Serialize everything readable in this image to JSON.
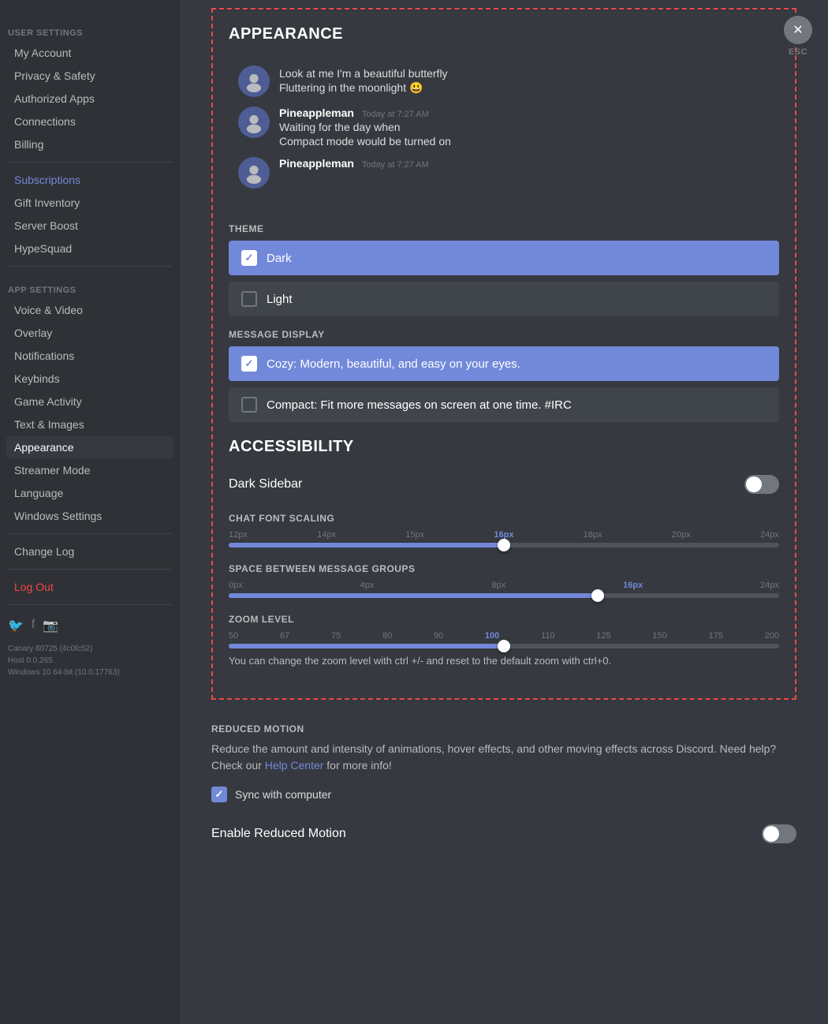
{
  "sidebar": {
    "user_settings_label": "USER SETTINGS",
    "app_settings_label": "APP SETTINGS",
    "items": {
      "my_account": "My Account",
      "privacy_safety": "Privacy & Safety",
      "authorized_apps": "Authorized Apps",
      "connections": "Connections",
      "billing": "Billing",
      "subscriptions": "Subscriptions",
      "gift_inventory": "Gift Inventory",
      "server_boost": "Server Boost",
      "hypesquad": "HypeSquad",
      "voice_video": "Voice & Video",
      "overlay": "Overlay",
      "notifications": "Notifications",
      "keybinds": "Keybinds",
      "game_activity": "Game Activity",
      "text_images": "Text & Images",
      "appearance": "Appearance",
      "streamer_mode": "Streamer Mode",
      "language": "Language",
      "windows_settings": "Windows Settings",
      "change_log": "Change Log",
      "log_out": "Log Out"
    }
  },
  "esc": {
    "label": "ESC"
  },
  "appearance": {
    "title": "APPEARANCE",
    "chat_preview": {
      "messages": [
        {
          "id": "msg1",
          "show_avatar": true,
          "avatar_type": "pineappleman",
          "show_author": false,
          "text": "Look at me I'm a beautiful butterfly",
          "text2": "Fluttering in the moonlight 😃"
        },
        {
          "id": "msg2",
          "show_avatar": true,
          "avatar_type": "pineappleman",
          "author": "Pineappleman",
          "timestamp": "Today at 7:27 AM",
          "text": "Waiting for the day when",
          "text2": "Compact mode would be turned on"
        },
        {
          "id": "msg3",
          "show_avatar": true,
          "avatar_type": "pineappleman",
          "author": "Pineappleman",
          "timestamp": "Today at 7:27 AM",
          "text": ""
        }
      ]
    },
    "theme_label": "THEME",
    "themes": [
      {
        "id": "dark",
        "label": "Dark",
        "selected": true
      },
      {
        "id": "light",
        "label": "Light",
        "selected": false
      }
    ],
    "message_display_label": "MESSAGE DISPLAY",
    "message_displays": [
      {
        "id": "cozy",
        "label": "Cozy: Modern, beautiful, and easy on your eyes.",
        "selected": true
      },
      {
        "id": "compact",
        "label": "Compact: Fit more messages on screen at one time. #IRC",
        "selected": false
      }
    ]
  },
  "accessibility": {
    "title": "ACCESSIBILITY",
    "dark_sidebar": {
      "label": "Dark Sidebar",
      "enabled": false
    },
    "chat_font_scaling": {
      "label": "CHAT FONT SCALING",
      "marks": [
        "12px",
        "14px",
        "15px",
        "16px",
        "18px",
        "20px",
        "24px"
      ],
      "active_mark": "16px",
      "fill_percent": 50,
      "thumb_percent": 50
    },
    "space_between_groups": {
      "label": "SPACE BETWEEN MESSAGE GROUPS",
      "marks": [
        "0px",
        "4px",
        "8px",
        "16px",
        "24px"
      ],
      "active_mark": "16px",
      "fill_percent": 67,
      "thumb_percent": 67
    },
    "zoom_level": {
      "label": "ZOOM LEVEL",
      "marks": [
        "50",
        "67",
        "75",
        "80",
        "90",
        "100",
        "110",
        "125",
        "150",
        "175",
        "200"
      ],
      "active_mark": "100",
      "fill_percent": 50,
      "thumb_percent": 50,
      "hint": "You can change the zoom level with ctrl +/- and reset to the default zoom with ctrl+0."
    }
  },
  "reduced_motion": {
    "label": "REDUCED MOTION",
    "description_before": "Reduce the amount and intensity of animations, hover effects, and other moving effects across Discord. Need help? Check our ",
    "help_link": "Help Center",
    "description_after": " for more info!",
    "sync_label": "Sync with computer",
    "sync_checked": true,
    "enable_label": "Enable Reduced Motion",
    "enable_enabled": false
  },
  "version": {
    "line1": "Canary 80725 (4c0fc52)",
    "line2": "Host 0.0.265",
    "line3": "Windows 10 64-bit (10.0.17763)"
  }
}
